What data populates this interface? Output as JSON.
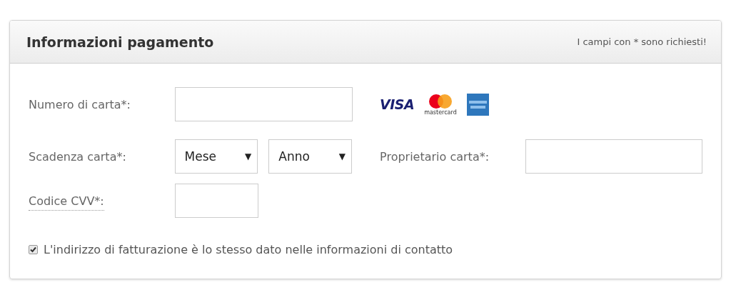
{
  "panel": {
    "title": "Informazioni pagamento",
    "note": "I campi con * sono richiesti!"
  },
  "card_number": {
    "label": "Numero di carta*:"
  },
  "card_logos": {
    "visa": "VISA",
    "mastercard": "mastercard"
  },
  "expiry": {
    "label": "Scadenza carta*:",
    "month": {
      "value": "Mese",
      "caret": "▼"
    },
    "year": {
      "value": "Anno",
      "caret": "▼"
    }
  },
  "owner": {
    "label": "Proprietario carta*:"
  },
  "cvv": {
    "label": "Codice CVV*:"
  },
  "billing_same": {
    "label": "L'indirizzo di fatturazione è lo stesso dato nelle informazioni di contatto",
    "checked": true
  }
}
